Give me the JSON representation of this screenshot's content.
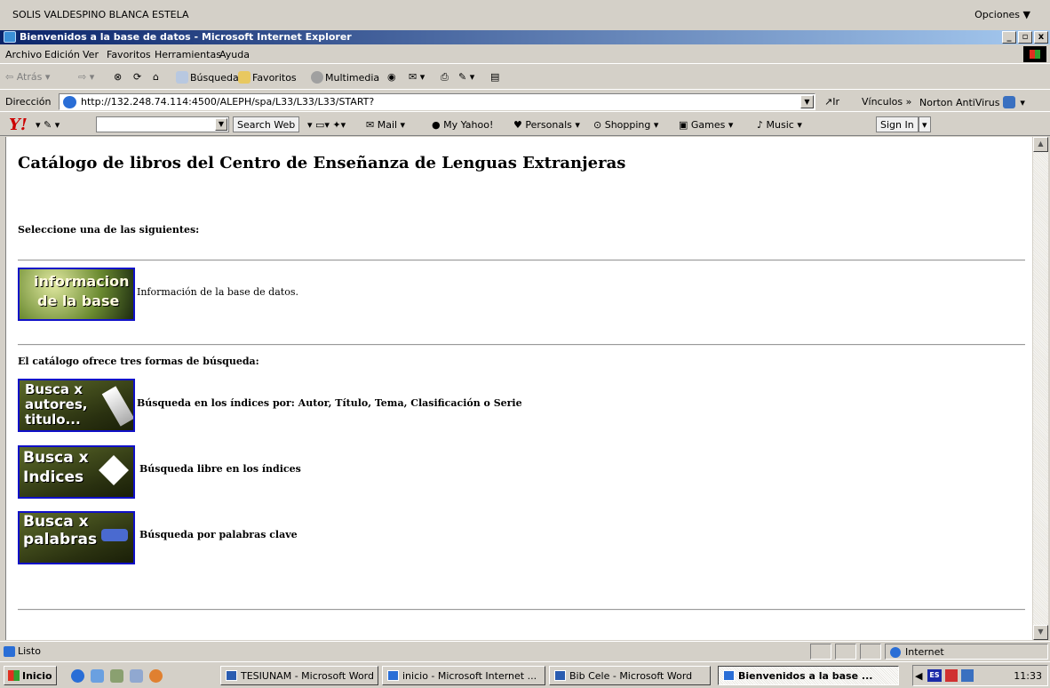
{
  "topbar": {
    "user": "SOLIS VALDESPINO BLANCA ESTELA",
    "options": "Opciones ▼"
  },
  "window": {
    "title": "Bienvenidos a la base de datos - Microsoft Internet Explorer",
    "min": "_",
    "max": "▫",
    "close": "x"
  },
  "menu": [
    "Archivo",
    "Edición",
    "Ver",
    "Favoritos",
    "Herramientas",
    "Ayuda"
  ],
  "toolbar": {
    "back": "Atrás",
    "search": "Búsqueda",
    "favorites": "Favoritos",
    "media": "Multimedia"
  },
  "address": {
    "label": "Dirección",
    "url": "http://132.248.74.114:4500/ALEPH/spa/L33/L33/L33/START?",
    "go": "Ir",
    "links": "Vínculos »",
    "norton": "Norton AntiVirus"
  },
  "yahoo": {
    "logo": "Y!",
    "search_btn": "Search Web",
    "items": [
      "Mail",
      "My Yahoo!",
      "Personals",
      "Shopping",
      "Games",
      "Music"
    ],
    "signin": "Sign In"
  },
  "page": {
    "title": "Catálogo de libros del Centro de Enseñanza de Lenguas Extranjeras",
    "prompt": "Seleccione una de las siguientes:",
    "info_button": [
      "informacion",
      "de la base"
    ],
    "info_desc": "Información de la base de datos.",
    "search_intro": "El catálogo ofrece tres formas de búsqueda:",
    "btn1": [
      "Busca x",
      "autores,",
      "titulo..."
    ],
    "btn1_desc": "Búsqueda en los índices por: Autor, Título, Tema, Clasificación o Serie",
    "btn2": [
      "Busca x",
      "Indices"
    ],
    "btn2_desc": "Búsqueda libre en los índices",
    "btn3": [
      "Busca x",
      "palabras"
    ],
    "btn3_desc": "Búsqueda por palabras clave"
  },
  "status": {
    "text": "Listo",
    "zone": "Internet"
  },
  "taskbar": {
    "start": "Inicio",
    "tasks": [
      "TESIUNAM - Microsoft Word",
      "inicio - Microsoft Internet ...",
      "Bib Cele - Microsoft Word",
      "Bienvenidos a la base ..."
    ],
    "lang": "ES",
    "clock": "11:33"
  }
}
